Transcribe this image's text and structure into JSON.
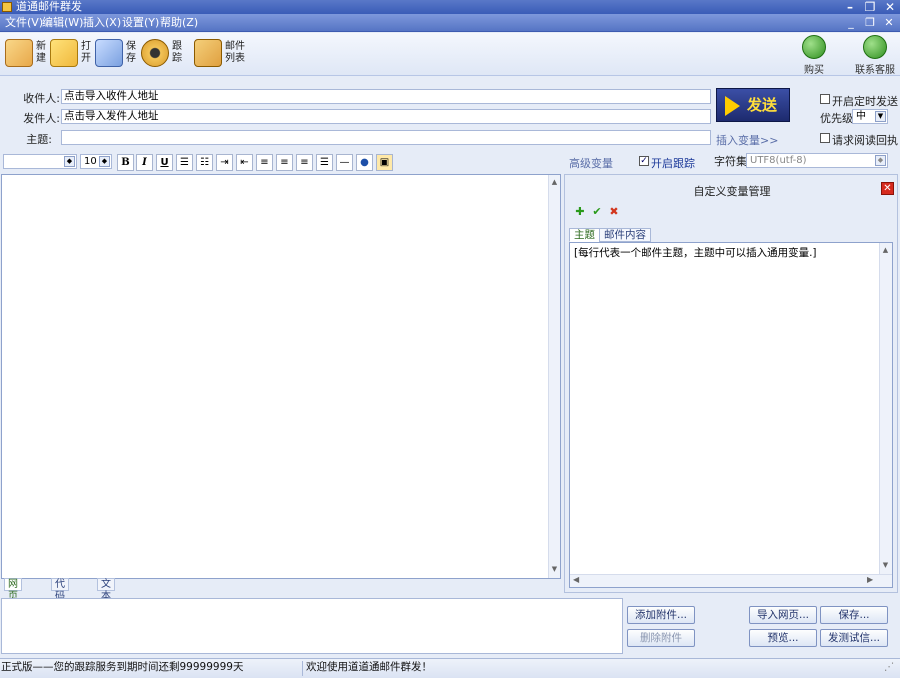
{
  "window": {
    "title": "道通邮件群发",
    "controls": {
      "minimize": "–",
      "restore": "❐",
      "close": "✕"
    }
  },
  "menu": {
    "items": [
      "文件(V)",
      "编辑(W)",
      "插入(X)",
      "设置(Y)",
      "帮助(Z)"
    ],
    "mdi_controls": {
      "minimize": "_",
      "restore": "❐",
      "close": "✕"
    }
  },
  "toolbar": {
    "left": [
      {
        "label": "新建",
        "icon": "new-doc-icon",
        "color": "#e8a84a"
      },
      {
        "label": "打开",
        "icon": "open-folder-icon",
        "color": "#f0b83c"
      },
      {
        "label": "保存",
        "icon": "save-disk-icon",
        "color": "#7aa0e0"
      },
      {
        "label": "跟踪",
        "icon": "track-eye-icon",
        "color": "#d89a2a"
      },
      {
        "label": "邮件列表",
        "icon": "mail-list-icon",
        "color": "#e0a040"
      }
    ],
    "right": [
      {
        "label": "购买",
        "icon": "cart-icon"
      },
      {
        "label": "联系客服",
        "icon": "globe-support-icon"
      }
    ]
  },
  "header": {
    "to_label": "收件人:",
    "to_value": "点击导入收件人地址",
    "from_label": "发件人:",
    "from_value": "点击导入发件人地址",
    "subject_label": "主题:",
    "subject_value": "",
    "insert_var": "插入变量>>",
    "send": "发送",
    "scheduled_send": "开启定时发送",
    "priority_label": "优先级",
    "priority_value": "中",
    "read_receipt": "请求阅读回执"
  },
  "format": {
    "font_size": "10",
    "advanced_vars": "高级变量",
    "tracking_label": "开启跟踪",
    "tracking_checked": true,
    "charset_label": "字符集",
    "charset_value": "UTF8(utf-8)",
    "buttons": [
      "bold-button",
      "italic-button",
      "underline-button",
      "ordered-list-button",
      "unordered-list-button",
      "indent-button",
      "outdent-button",
      "align-left-button",
      "align-center-button",
      "align-right-button",
      "justify-button",
      "horizontal-rule-button",
      "insert-link-button",
      "insert-image-button"
    ]
  },
  "editor_tabs": [
    "网页视图",
    "代码视图",
    "文本视图"
  ],
  "var_panel": {
    "title": "自定义变量管理",
    "tabs": [
      "主题",
      "邮件内容"
    ],
    "content": "[每行代表一个邮件主题，主题中可以插入通用变量.]"
  },
  "attachments": {
    "add": "添加附件...",
    "remove": "删除附件"
  },
  "actions": {
    "import_web": "导入网页...",
    "save": "保存...",
    "preview": "预览...",
    "test_send": "发测试信..."
  },
  "status": {
    "left": "正式版——您的跟踪服务到期时间还剩99999999天",
    "right": "欢迎使用道道通邮件群发！"
  }
}
